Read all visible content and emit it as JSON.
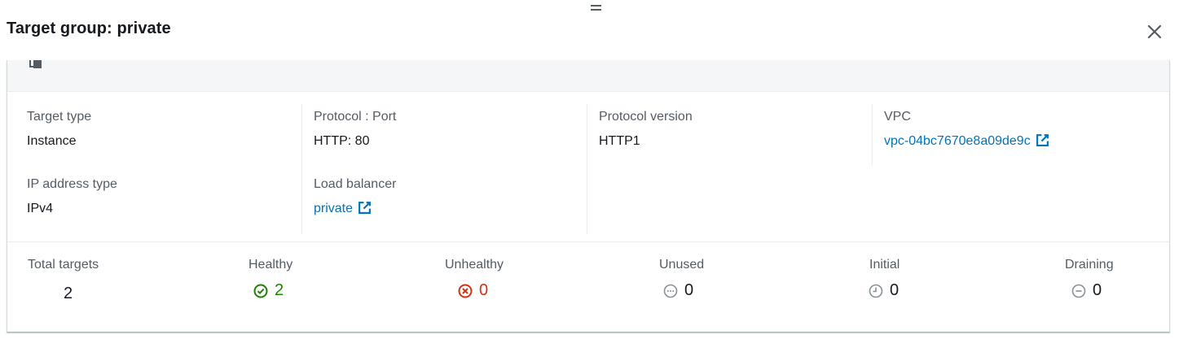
{
  "panel": {
    "title": "Target group: private"
  },
  "details": {
    "target_type": {
      "label": "Target type",
      "value": "Instance"
    },
    "protocol_port": {
      "label": "Protocol : Port",
      "value": "HTTP: 80"
    },
    "protocol_version": {
      "label": "Protocol version",
      "value": "HTTP1"
    },
    "vpc": {
      "label": "VPC",
      "value": "vpc-04bc7670e8a09de9c"
    },
    "ip_address_type": {
      "label": "IP address type",
      "value": "IPv4"
    },
    "load_balancer": {
      "label": "Load balancer",
      "value": "private"
    }
  },
  "stats": {
    "total": {
      "label": "Total targets",
      "value": "2"
    },
    "healthy": {
      "label": "Healthy",
      "value": "2",
      "icon": "check-circle-icon",
      "color": "#1d8102"
    },
    "unhealthy": {
      "label": "Unhealthy",
      "value": "0",
      "icon": "x-circle-icon",
      "color": "#d13212"
    },
    "unused": {
      "label": "Unused",
      "value": "0",
      "icon": "ellipsis-circle-icon",
      "color": "#879196"
    },
    "initial": {
      "label": "Initial",
      "value": "0",
      "icon": "clock-circle-icon",
      "color": "#879196"
    },
    "draining": {
      "label": "Draining",
      "value": "0",
      "icon": "minus-circle-icon",
      "color": "#879196"
    }
  },
  "colors": {
    "link": "#0073bb",
    "label": "#545b64",
    "text": "#16191f"
  }
}
